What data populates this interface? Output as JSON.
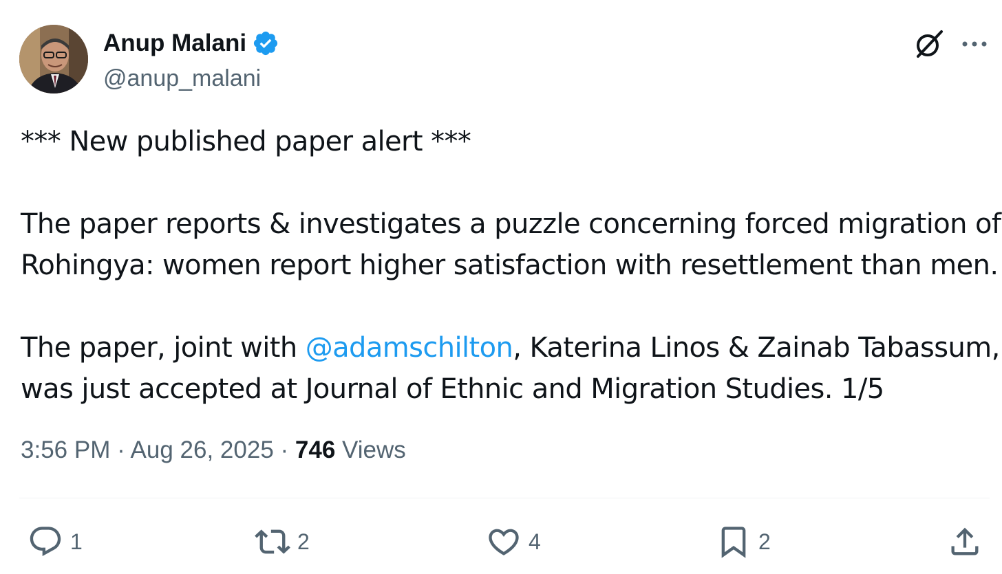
{
  "author": {
    "name": "Anup Malani",
    "handle": "@anup_malani",
    "verified": true,
    "verified_color": "#1d9bf0"
  },
  "header_icons": [
    "grok-icon",
    "more-icon"
  ],
  "tweet": {
    "line1": "*** New published paper alert ***",
    "para2_line1": "The paper reports & investigates a puzzle concerning forced migration of",
    "para2_line2": "Rohingya: women report higher satisfaction with resettlement than men.",
    "para3_line1_before": "The paper, joint with ",
    "mention": "@adamschilton",
    "para3_line1_after": ", Katerina Linos & Zainab Tabassum,",
    "para3_line2": "was just accepted at Journal of Ethnic and Migration Studies. 1/5"
  },
  "meta": {
    "time": "3:56 PM",
    "separator": " · ",
    "date": "Aug 26, 2025",
    "views_count": "746",
    "views_label": " Views"
  },
  "actions": {
    "reply_count": "1",
    "repost_count": "2",
    "like_count": "4",
    "bookmark_count": "2"
  },
  "colors": {
    "text": "#0f1419",
    "secondary": "#536471",
    "link": "#1d9bf0"
  }
}
